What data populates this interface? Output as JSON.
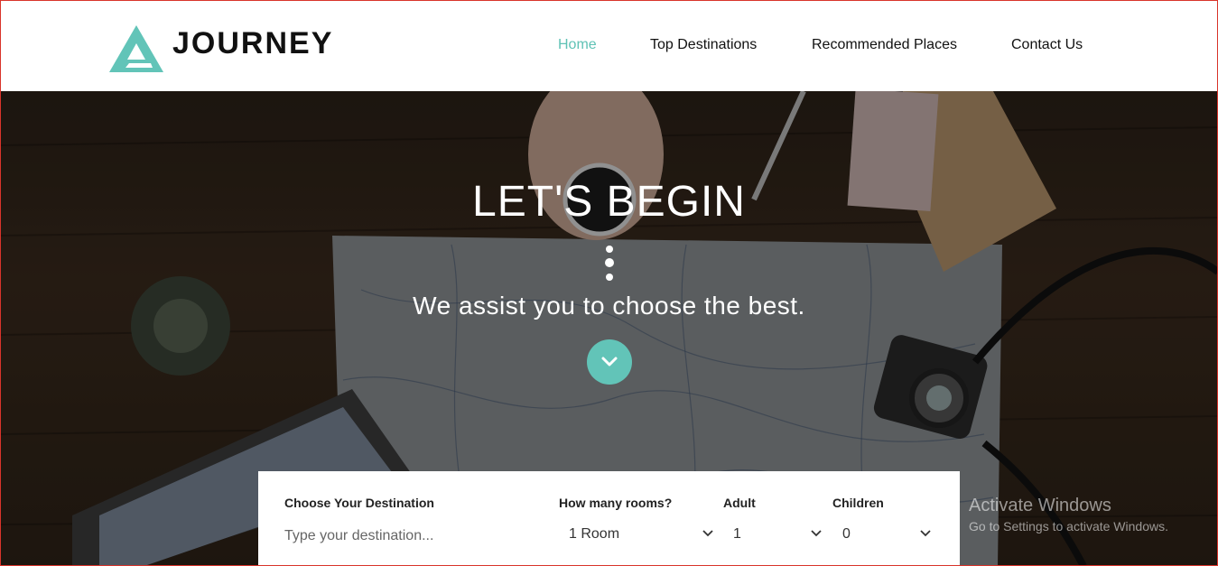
{
  "brand": {
    "name": "JOURNEY"
  },
  "nav": {
    "items": [
      {
        "label": "Home",
        "active": true
      },
      {
        "label": "Top Destinations",
        "active": false
      },
      {
        "label": "Recommended Places",
        "active": false
      },
      {
        "label": "Contact Us",
        "active": false
      }
    ]
  },
  "hero": {
    "title": "LET'S BEGIN",
    "subtitle": "We assist you to choose the best.",
    "scroll_icon": "chevron-down-icon"
  },
  "search": {
    "destination_label": "Choose Your Destination",
    "destination_placeholder": "Type your destination...",
    "rooms_label": "How many rooms?",
    "rooms_value": "1 Room",
    "adult_label": "Adult",
    "adult_value": "1",
    "children_label": "Children",
    "children_value": "0"
  },
  "watermark": {
    "title": "Activate Windows",
    "subtitle": "Go to Settings to activate Windows."
  },
  "colors": {
    "accent": "#5fc2b5",
    "frame": "#d9342b"
  }
}
